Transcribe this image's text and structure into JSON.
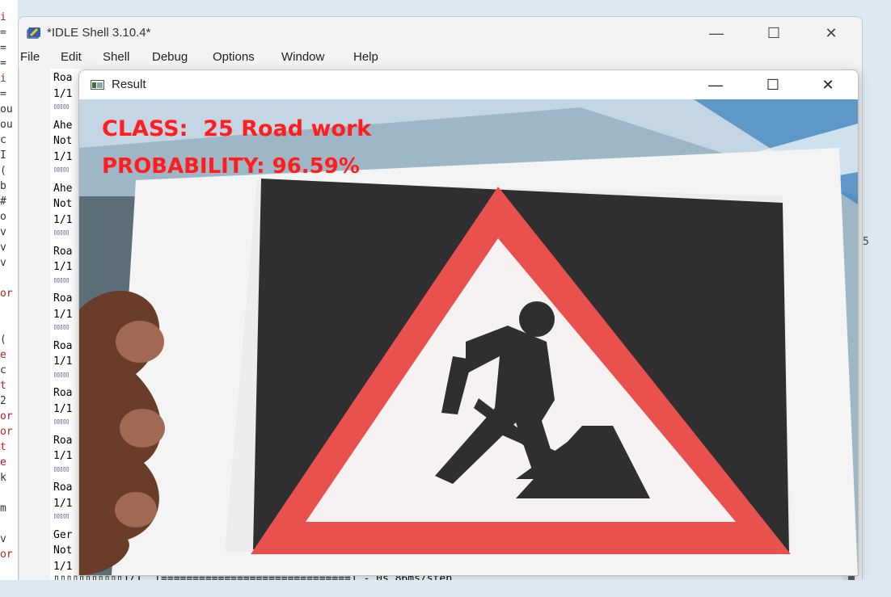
{
  "background_editor": {
    "lines": [
      "i",
      "=",
      "=",
      "=",
      "i",
      "=",
      "ou",
      "ou",
      "c",
      "I",
      "(",
      "b",
      "#",
      "o",
      "v",
      "v",
      "v",
      "",
      "or",
      "",
      "",
      "(",
      "e",
      "c",
      "t",
      "2",
      "or",
      "or",
      "t",
      "e",
      "k",
      "",
      "m",
      "",
      "v",
      "or"
    ]
  },
  "idle_window": {
    "title": "*IDLE Shell 3.10.4*",
    "controls": {
      "minimize": "—",
      "maximize": "☐",
      "close": "✕"
    },
    "menu": [
      "File",
      "Edit",
      "Shell",
      "Debug",
      "Options",
      "Window",
      "Help"
    ],
    "shell_lines": [
      {
        "text": "Roa",
        "type": "text"
      },
      {
        "text": "1/1",
        "type": "text"
      },
      {
        "text": "▯▯▯▯▯",
        "type": "boxes"
      },
      {
        "text": "Ahe",
        "type": "text"
      },
      {
        "text": "Not",
        "type": "text"
      },
      {
        "text": "1/1",
        "type": "text"
      },
      {
        "text": "▯▯▯▯▯",
        "type": "boxes"
      },
      {
        "text": "Ahe",
        "type": "text"
      },
      {
        "text": "Not",
        "type": "text"
      },
      {
        "text": "1/1",
        "type": "text"
      },
      {
        "text": "▯▯▯▯▯",
        "type": "boxes"
      },
      {
        "text": "Roa",
        "type": "text"
      },
      {
        "text": "1/1",
        "type": "text"
      },
      {
        "text": "▯▯▯▯▯",
        "type": "boxes"
      },
      {
        "text": "Roa",
        "type": "text"
      },
      {
        "text": "1/1",
        "type": "text"
      },
      {
        "text": "▯▯▯▯▯",
        "type": "boxes"
      },
      {
        "text": "Roa",
        "type": "text"
      },
      {
        "text": "1/1",
        "type": "text"
      },
      {
        "text": "▯▯▯▯▯",
        "type": "boxes"
      },
      {
        "text": "Roa",
        "type": "text"
      },
      {
        "text": "1/1",
        "type": "text"
      },
      {
        "text": "▯▯▯▯▯",
        "type": "boxes"
      },
      {
        "text": "Roa",
        "type": "text"
      },
      {
        "text": "1/1",
        "type": "text"
      },
      {
        "text": "▯▯▯▯▯",
        "type": "boxes"
      },
      {
        "text": "Roa",
        "type": "text"
      },
      {
        "text": "1/1",
        "type": "text"
      },
      {
        "text": "▯▯▯▯▯",
        "type": "boxes"
      },
      {
        "text": "Ger",
        "type": "text"
      },
      {
        "text": "Not",
        "type": "text"
      },
      {
        "text": "1/1",
        "type": "text"
      }
    ],
    "progress_line": "▯▯▯▯▯▯▯▯▯▯▯1/1  [==============================] - 0s 86ms/step",
    "side_digit": "5"
  },
  "result_window": {
    "title": "Result",
    "controls": {
      "minimize": "—",
      "maximize": "☐",
      "close": "✕"
    },
    "class_text": "CLASS:  25 Road work",
    "probability_text": "PROBABILITY: 96.59%"
  },
  "colors": {
    "overlay_text": "#ff1d1d",
    "sign_border": "#e8514d",
    "sign_background": "#2f2e30"
  }
}
